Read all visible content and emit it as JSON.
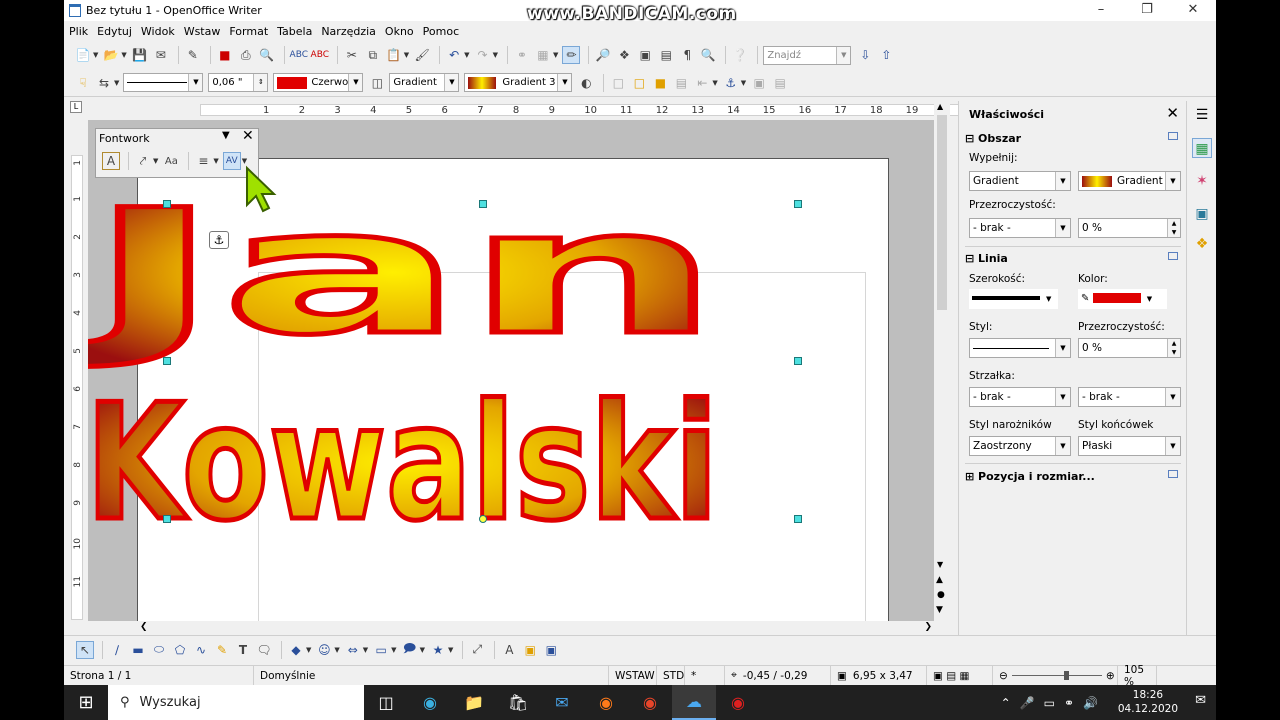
{
  "window": {
    "title": "Bez tytułu 1 - OpenOffice Writer",
    "watermark": "www.BANDICAM.com"
  },
  "menu": [
    "Plik",
    "Edytuj",
    "Widok",
    "Wstaw",
    "Format",
    "Tabela",
    "Narzędzia",
    "Okno",
    "Pomoc"
  ],
  "toolbar1": {
    "find_placeholder": "Znajdź"
  },
  "toolbar2": {
    "line_width": "0,06 \"",
    "line_color": "Czerwo",
    "area_style": "Gradient",
    "gradient": "Gradient 3"
  },
  "ruler": {
    "h_ticks": [
      "1",
      "2",
      "3",
      "4",
      "5",
      "6",
      "7",
      "8",
      "9",
      "10",
      "11",
      "12",
      "13",
      "14",
      "15",
      "16",
      "17",
      "18",
      "19"
    ],
    "v_ticks": [
      "1",
      "1",
      "2",
      "3",
      "4",
      "5",
      "6",
      "7",
      "8",
      "9",
      "10",
      "11"
    ]
  },
  "fontwork": {
    "title": "Fontwork"
  },
  "document": {
    "line1": "Jan",
    "line2": "Kowalski"
  },
  "sidebar": {
    "title": "Właściwości",
    "area": {
      "header": "Obszar",
      "fill_label": "Wypełnij:",
      "fill_value": "Gradient",
      "gradient_value": "Gradient 3",
      "transp_label": "Przezroczystość:",
      "transp_value": "- brak -",
      "transp_pct": "0 %"
    },
    "line": {
      "header": "Linia",
      "width_label": "Szerokość:",
      "color_label": "Kolor:",
      "style_label": "Styl:",
      "transp_label": "Przezroczystość:",
      "transp_pct": "0 %",
      "arrow_label": "Strzałka:",
      "arrow_start": "- brak -",
      "arrow_end": "- brak -",
      "corner_label": "Styl narożników",
      "corner_value": "Zaostrzony",
      "cap_label": "Styl końcówek",
      "cap_value": "Płaski"
    },
    "pos_header": "Pozycja i rozmiar..."
  },
  "status": {
    "page": "Strona 1 / 1",
    "style": "Domyślnie",
    "insert": "WSTAW",
    "std": "STD",
    "star": "*",
    "position": "-0,45 / -0,29",
    "size": "6,95 x 3,47",
    "zoom": "105 %"
  },
  "taskbar": {
    "search": "Wyszukaj",
    "time": "18:26",
    "date": "04.12.2020"
  },
  "colors": {
    "line_red": "#e00000",
    "gradient_outer": "#9b0f0f",
    "gradient_inner": "#ffef00"
  }
}
